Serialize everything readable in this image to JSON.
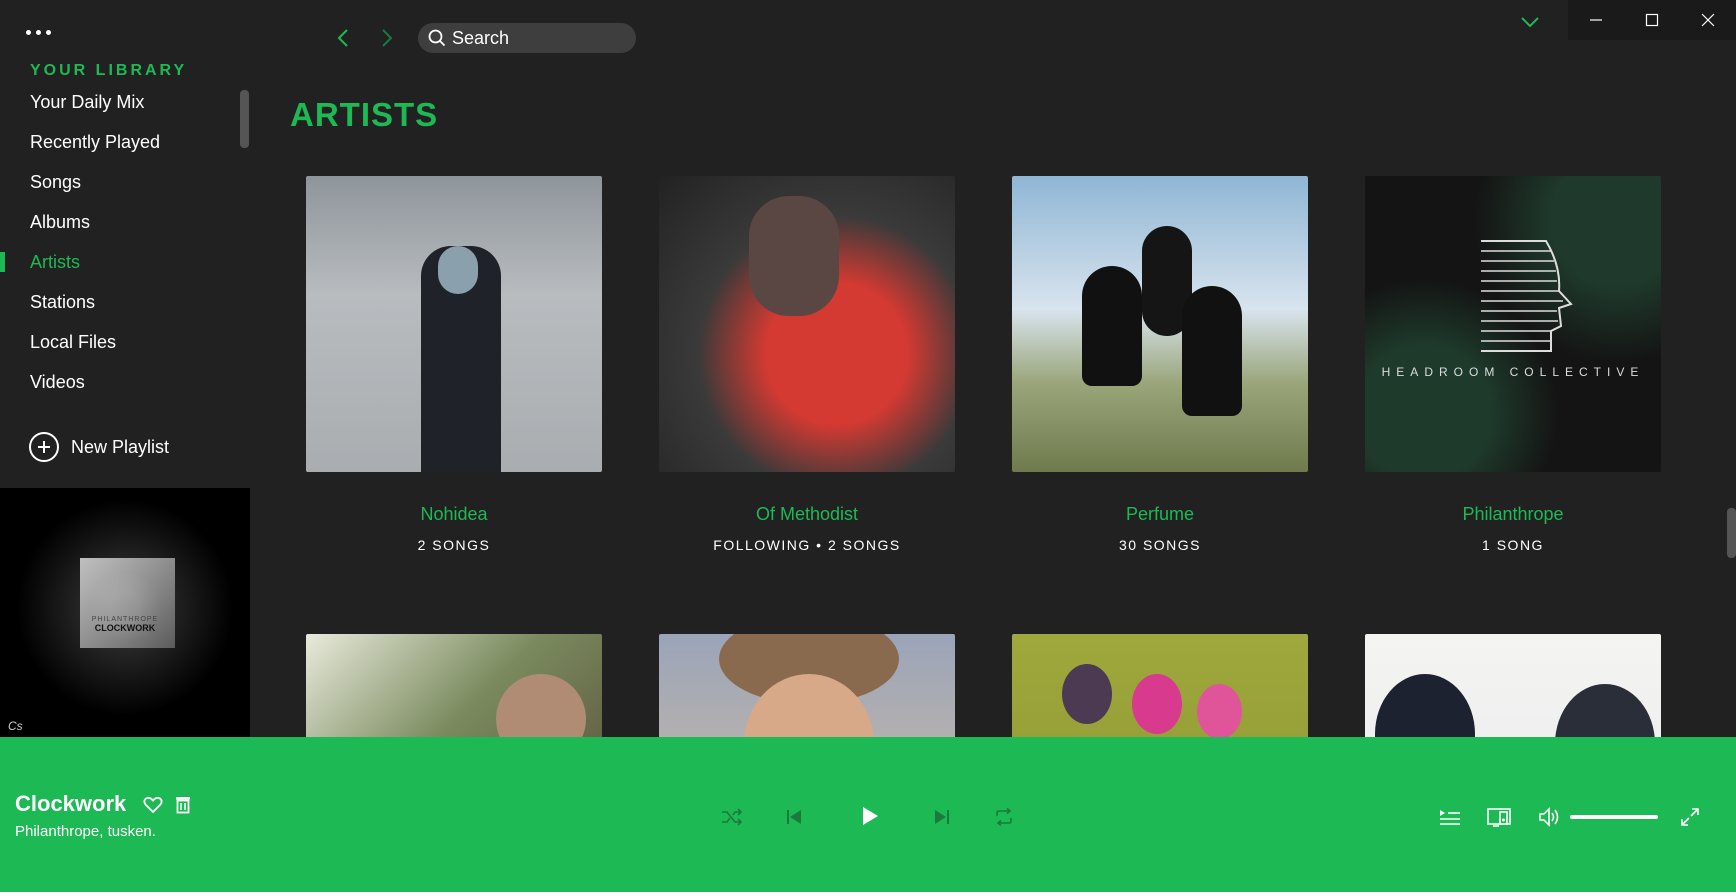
{
  "sidebar": {
    "library_title": "YOUR LIBRARY",
    "items": [
      {
        "label": "Your Daily Mix"
      },
      {
        "label": "Recently Played"
      },
      {
        "label": "Songs"
      },
      {
        "label": "Albums"
      },
      {
        "label": "Artists",
        "active": true
      },
      {
        "label": "Stations"
      },
      {
        "label": "Local Files"
      },
      {
        "label": "Videos"
      }
    ],
    "new_playlist_label": "New Playlist",
    "now_playing_art": {
      "text": "CLOCKWORK",
      "subtext": "PHILANTHROPE"
    }
  },
  "topbar": {
    "search_placeholder": "Search",
    "back_icon": "chevron-left-icon",
    "forward_icon": "chevron-right-icon"
  },
  "main": {
    "title": "ARTISTS",
    "artists": [
      {
        "name": "Nohidea",
        "meta": "2 SONGS"
      },
      {
        "name": "Of Methodist",
        "meta": "FOLLOWING • 2 SONGS"
      },
      {
        "name": "Perfume",
        "meta": "30 SONGS"
      },
      {
        "name": "Philanthrope",
        "meta": "1 SONG"
      },
      {
        "name": "",
        "meta": ""
      },
      {
        "name": "",
        "meta": ""
      },
      {
        "name": "",
        "meta": ""
      },
      {
        "name": "",
        "meta": ""
      }
    ],
    "headroom_logo_text": "HEADROOM COLLECTIVE"
  },
  "player": {
    "title": "Clockwork",
    "artist": "Philanthrope, tusken.",
    "volume": 1.0
  },
  "colors": {
    "accent": "#1db954",
    "background": "#212121",
    "player_bg": "#1db954"
  }
}
